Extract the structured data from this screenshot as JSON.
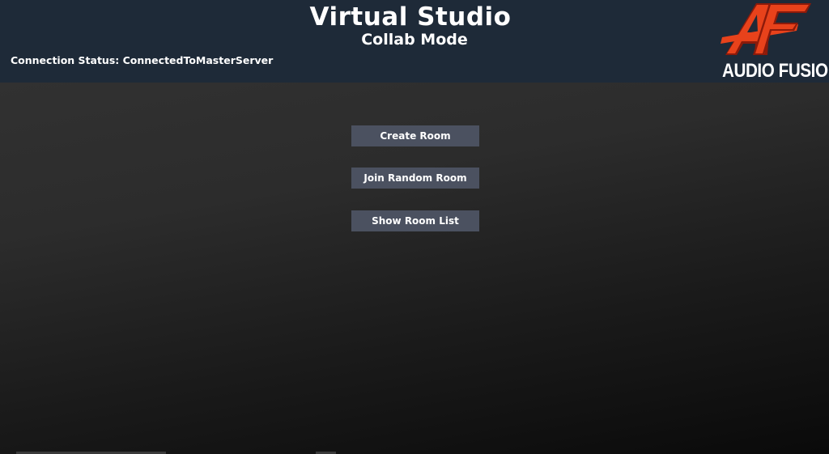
{
  "header": {
    "title": "Virtual Studio",
    "subtitle": "Collab Mode",
    "connection_status": "Connection Status: ConnectedToMasterServer",
    "logo": {
      "text": "AUDIO FUSION",
      "icon": "af-logo-icon",
      "colors": {
        "primary": "#e8421b",
        "dark": "#8c1a0a"
      }
    }
  },
  "menu": {
    "create_room": "Create Room",
    "join_random_room": "Join Random Room",
    "show_room_list": "Show Room List"
  },
  "colors": {
    "header_bg": "#1e2a38",
    "button_bg": "#4b5160",
    "text": "#ffffff"
  }
}
